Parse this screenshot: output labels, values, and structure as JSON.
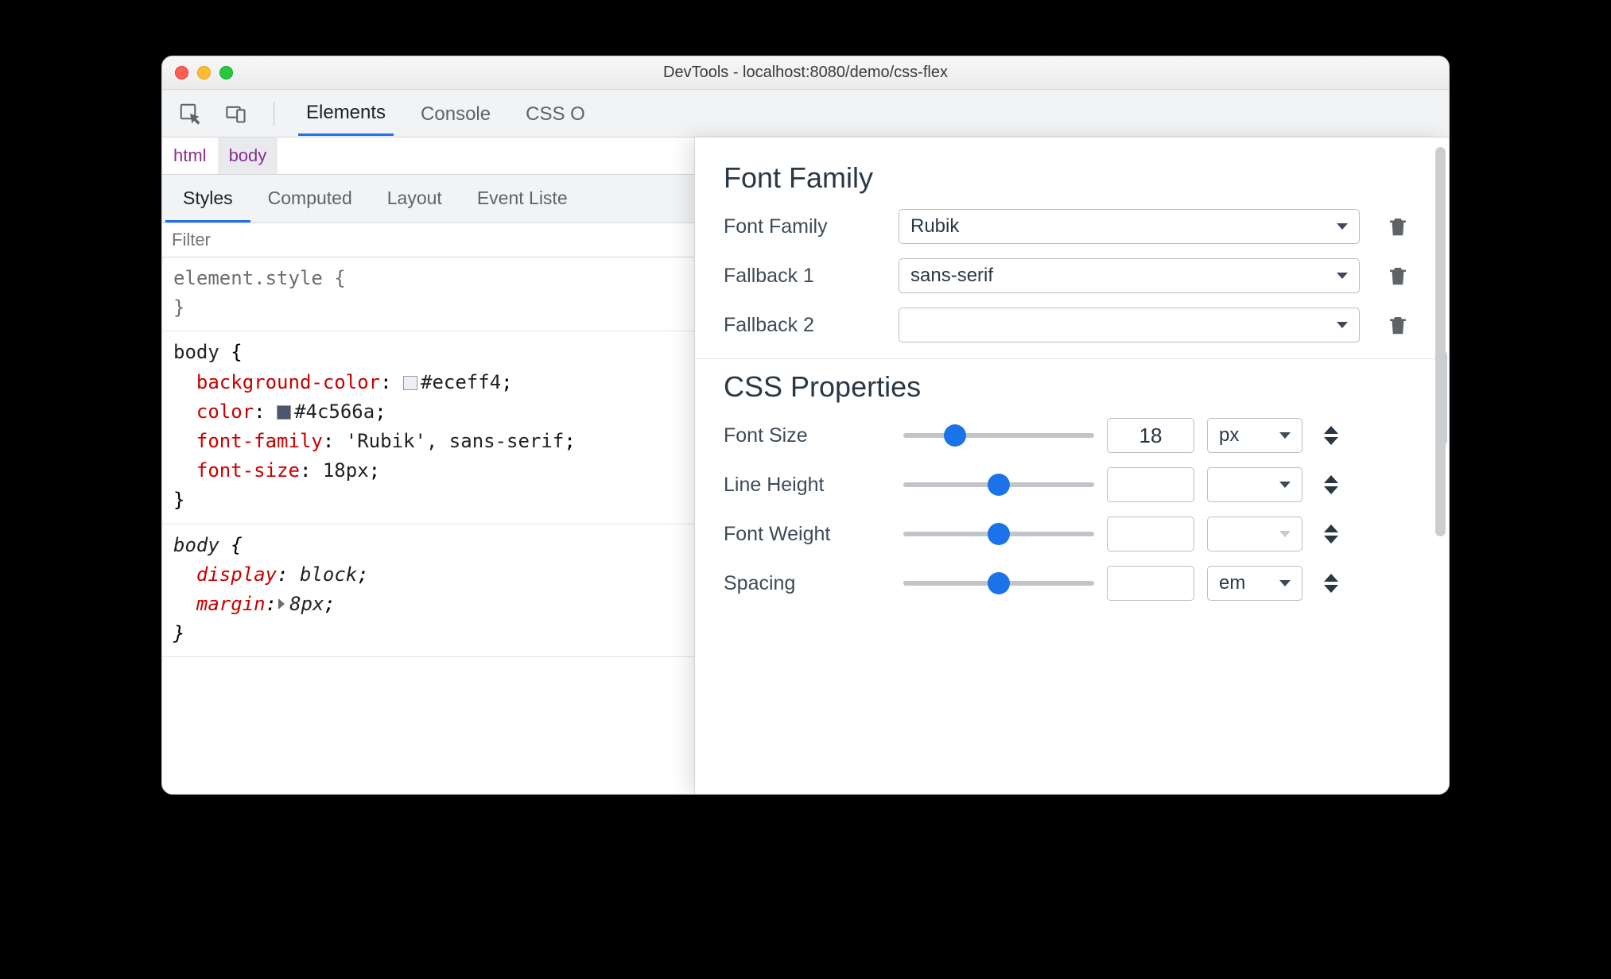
{
  "window": {
    "title": "DevTools - localhost:8080/demo/css-flex"
  },
  "tabbar": {
    "tabs": [
      "Elements",
      "Console",
      "CSS Overview"
    ],
    "active_index": 0,
    "tab2_visible": "CSS O"
  },
  "breadcrumbs": {
    "items": [
      "html",
      "body"
    ],
    "selected_index": 1
  },
  "subtabs": {
    "items": [
      "Styles",
      "Computed",
      "Layout",
      "Event Listeners"
    ],
    "active_index": 0,
    "item3_visible": "Event Liste"
  },
  "filter": {
    "placeholder": "Filter"
  },
  "styles_blocks": [
    {
      "selector": "element.style",
      "gray": true,
      "declarations": []
    },
    {
      "selector": "body",
      "declarations": [
        {
          "prop": "background-color",
          "value": "#eceff4",
          "swatch": "#eceff4"
        },
        {
          "prop": "color",
          "value": "#4c566a",
          "swatch": "#4c566a"
        },
        {
          "prop": "font-family",
          "value": "'Rubik', sans-serif"
        },
        {
          "prop": "font-size",
          "value": "18px"
        }
      ]
    },
    {
      "selector": "body",
      "italic": true,
      "declarations": [
        {
          "prop": "display",
          "value": "block"
        },
        {
          "prop": "margin",
          "value": "8px",
          "expand": true
        }
      ]
    }
  ],
  "font_panel": {
    "section1_title": "Font Family",
    "rows": [
      {
        "label": "Font Family",
        "value": "Rubik"
      },
      {
        "label": "Fallback 1",
        "value": "sans-serif"
      },
      {
        "label": "Fallback 2",
        "value": ""
      }
    ],
    "section2_title": "CSS Properties",
    "props": [
      {
        "label": "Font Size",
        "value": "18",
        "unit": "px",
        "thumb_pct": 27
      },
      {
        "label": "Line Height",
        "value": "",
        "unit": "",
        "thumb_pct": 50
      },
      {
        "label": "Font Weight",
        "value": "",
        "unit": "",
        "thumb_pct": 50,
        "unit_disabled": true
      },
      {
        "label": "Spacing",
        "value": "",
        "unit": "em",
        "thumb_pct": 50
      }
    ]
  }
}
